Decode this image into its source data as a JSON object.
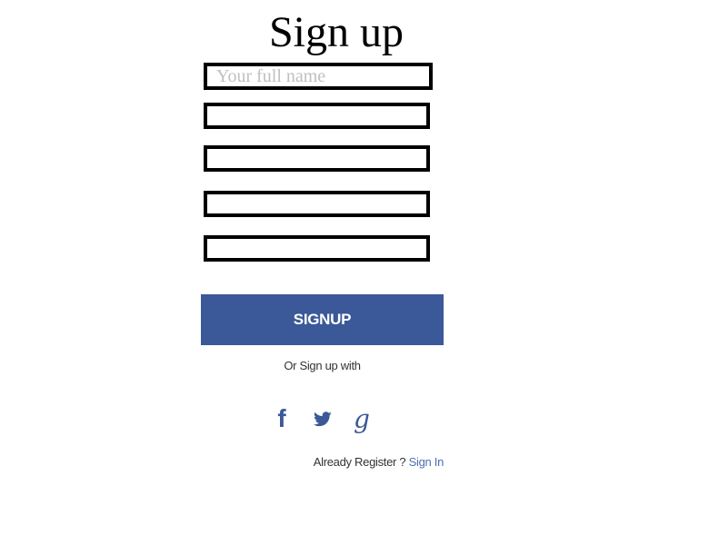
{
  "form": {
    "title": "Sign up",
    "fields": [
      {
        "value": "",
        "placeholder": "Your full name"
      },
      {
        "value": "",
        "placeholder": ""
      },
      {
        "value": "",
        "placeholder": ""
      },
      {
        "value": "",
        "placeholder": ""
      },
      {
        "value": "",
        "placeholder": ""
      }
    ],
    "submit_label": "SIGNUP"
  },
  "social": {
    "prompt": "Or Sign up with",
    "icons": [
      "facebook-icon",
      "twitter-icon",
      "google-icon"
    ]
  },
  "footer": {
    "text": "Already Register ?",
    "link_label": "Sign In"
  },
  "colors": {
    "accent": "#3b5998",
    "link": "#4a6fb5",
    "field_border": "#000000"
  }
}
